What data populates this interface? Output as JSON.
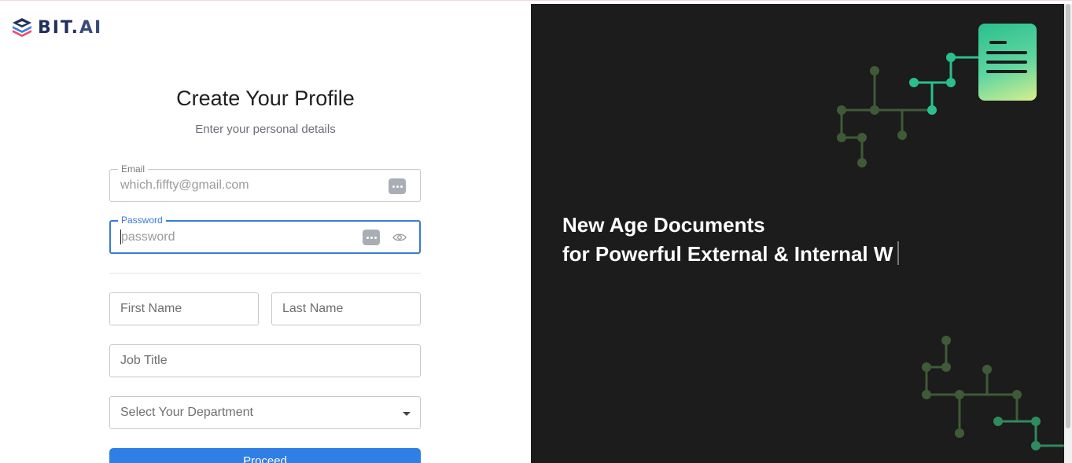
{
  "brand": {
    "logo_text_main": "BIT",
    "logo_text_dot": ".",
    "logo_text_ai": "AI"
  },
  "form": {
    "title": "Create Your Profile",
    "subtitle": "Enter your personal details",
    "email": {
      "label": "Email",
      "value": "which.fiffty@gmail.com"
    },
    "password": {
      "label": "Password",
      "placeholder": "password"
    },
    "first_name": {
      "placeholder": "First Name"
    },
    "last_name": {
      "placeholder": "Last Name"
    },
    "job_title": {
      "placeholder": "Job Title"
    },
    "department": {
      "placeholder": "Select Your Department"
    },
    "proceed_label": "Proceed"
  },
  "promo": {
    "line1": "New Age Documents",
    "line2": "for Powerful External & Internal W"
  },
  "colors": {
    "accent": "#2f7fe6",
    "focus": "#3a7bd5",
    "panel_bg": "#1c1c1c",
    "brand": "#22305e"
  },
  "icons": [
    "bit-ai-logo-icon",
    "password-manager-icon",
    "eye-icon",
    "chevron-down-icon",
    "document-icon"
  ]
}
